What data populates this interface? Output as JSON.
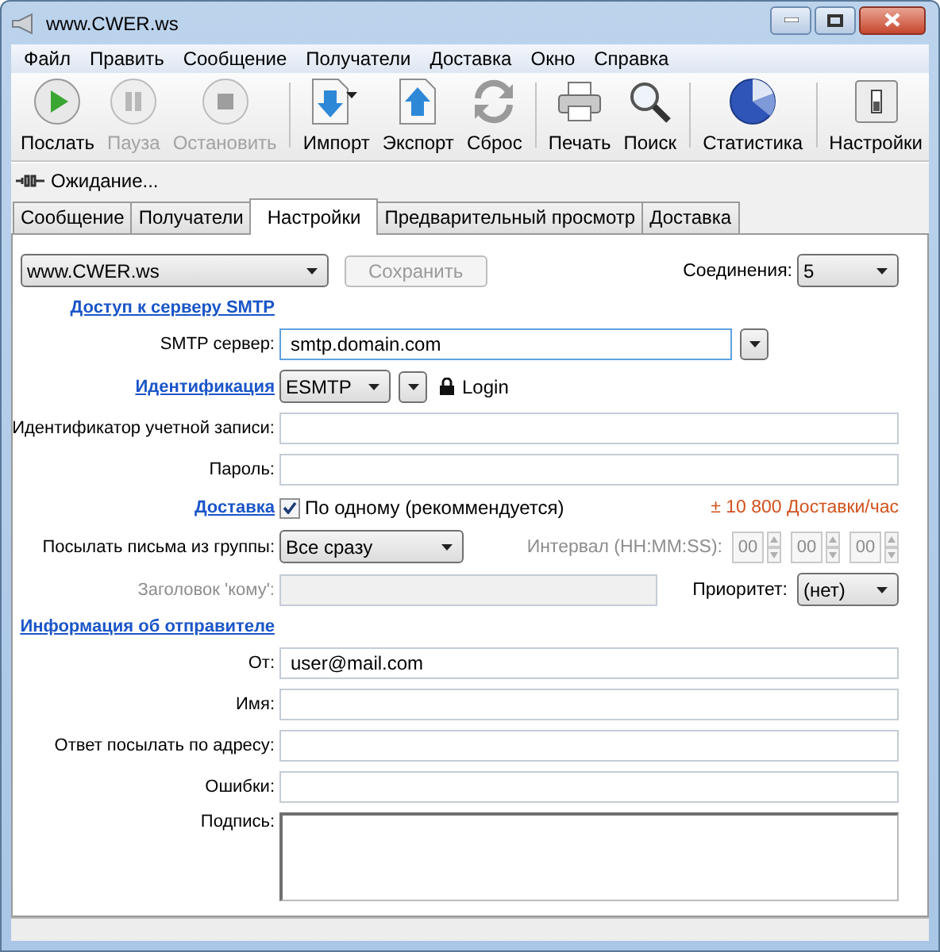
{
  "window": {
    "title": "www.CWER.ws"
  },
  "menu": [
    "Файл",
    "Править",
    "Сообщение",
    "Получатели",
    "Доставка",
    "Окно",
    "Справка"
  ],
  "toolbar": [
    {
      "items": [
        {
          "label": "Послать",
          "disabled": false,
          "dropdown": false
        },
        {
          "label": "Пауза",
          "disabled": true,
          "dropdown": false
        },
        {
          "label": "Остановить",
          "disabled": true,
          "dropdown": false
        }
      ]
    },
    {
      "items": [
        {
          "label": "Импорт",
          "disabled": false,
          "dropdown": true
        },
        {
          "label": "Экспорт",
          "disabled": false,
          "dropdown": false
        },
        {
          "label": "Сброс",
          "disabled": false,
          "dropdown": false
        }
      ]
    },
    {
      "items": [
        {
          "label": "Печать",
          "disabled": false,
          "dropdown": false
        },
        {
          "label": "Поиск",
          "disabled": false,
          "dropdown": false
        }
      ]
    },
    {
      "items": [
        {
          "label": "Статистика",
          "disabled": false,
          "dropdown": false
        }
      ]
    },
    {
      "items": [
        {
          "label": "Настройки",
          "disabled": false,
          "dropdown": false
        }
      ]
    }
  ],
  "status": "Ожидание...",
  "tabs": [
    {
      "label": "Сообщение",
      "selected": false
    },
    {
      "label": "Получатели",
      "selected": false
    },
    {
      "label": "Настройки",
      "selected": true
    },
    {
      "label": "Предварительный просмотр",
      "selected": false
    },
    {
      "label": "Доставка",
      "selected": false
    }
  ],
  "settings": {
    "profile": "www.CWER.ws",
    "save_button": {
      "label": "Сохранить",
      "disabled": true
    },
    "connections": {
      "label": "Соединения:",
      "value": "5"
    },
    "rows": [
      {
        "kind": "link",
        "text": "Доступ к серверу SMTP"
      },
      {
        "kind": "combo",
        "label": "SMTP сервер:",
        "value": "smtp.domain.com",
        "focused": true
      },
      {
        "kind": "auth",
        "link": "Идентификация",
        "value": "ESMTP",
        "lock_label": "Login"
      },
      {
        "kind": "field",
        "label": "Идентификатор учетной записи:"
      },
      {
        "kind": "field",
        "label": "Пароль:"
      },
      {
        "kind": "delivery",
        "link": "Доставка",
        "checked": true,
        "option": "По одному (рекоммендуется)",
        "rate": "± 10 800 Доставки/час"
      },
      {
        "kind": "group",
        "label": "Посылать письма из группы:",
        "value": "Все сразу",
        "interval_label": "Интервал (HH:MM:SS):",
        "interval_disabled": true,
        "interval": [
          "00",
          "00",
          "00"
        ]
      },
      {
        "kind": "header",
        "label": "Заголовок 'кому':",
        "disabled": true,
        "priority_label": "Приоритет:",
        "priority": "(нет)"
      },
      {
        "kind": "link",
        "text": "Информация об отправителе"
      },
      {
        "kind": "field",
        "label": "От:",
        "value": "user@mail.com"
      },
      {
        "kind": "field",
        "label": "Имя:"
      },
      {
        "kind": "field",
        "label": "Ответ посылать по адресу:"
      },
      {
        "kind": "field",
        "label": "Ошибки:"
      },
      {
        "kind": "textarea",
        "label": "Подпись:"
      }
    ]
  }
}
